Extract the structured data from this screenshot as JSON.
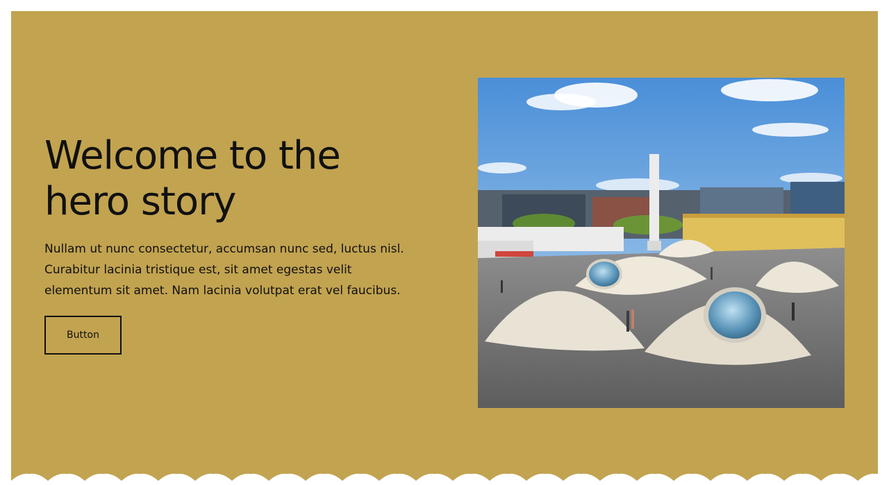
{
  "hero": {
    "title": "Welcome to the hero story",
    "text": "Nullam ut nunc consectetur, accumsan nunc sed, luctus nisl. Curabitur lacinia tristique est, sit amet egestas velit elementum sit amet. Nam lacinia volutpat erat vel faucibus.",
    "button_label": "Button"
  },
  "image": {
    "icon": "photo-plaza-with-domes"
  },
  "colors": {
    "background": "#c2a350",
    "text": "#111111",
    "page": "#ffffff"
  }
}
